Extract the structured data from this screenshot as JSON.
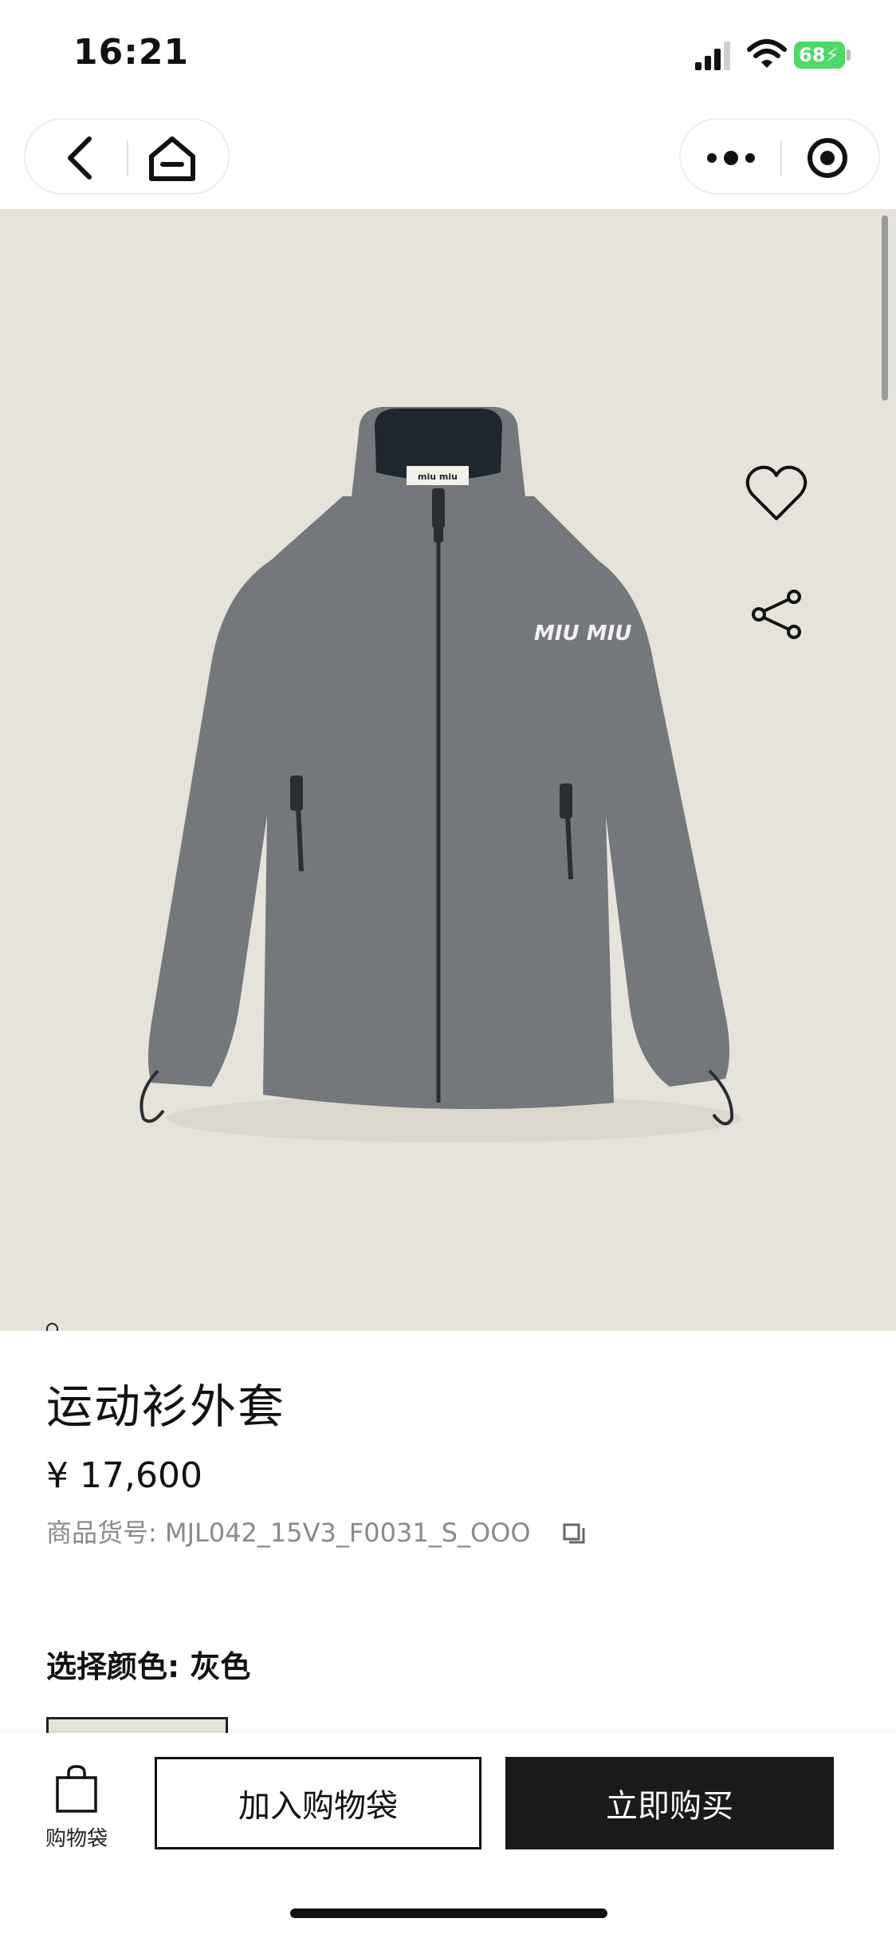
{
  "status_bar": {
    "time": "16:21",
    "battery_level": "68",
    "icons": [
      "signal-icon",
      "wifi-icon",
      "battery-charging-icon"
    ]
  },
  "nav": {
    "left_icons": [
      "back-icon",
      "home-icon"
    ],
    "right_icons": [
      "more-icon",
      "close-miniprogram-icon"
    ]
  },
  "gallery": {
    "background_color": "#e6e3da",
    "image_count": 6,
    "active_index": 1,
    "brand_text": "MIU MIU",
    "actions": [
      "heart-icon",
      "share-icon",
      "chat-icon"
    ]
  },
  "product": {
    "title": "运动衫外套",
    "price": "¥ 17,600",
    "sku": "商品货号: MJL042_15V3_F0031_S_OOO",
    "color_label": "选择颜色: 灰色"
  },
  "bottom_bar": {
    "bag_label": "购物袋",
    "add_to_cart_label": "加入购物袋",
    "buy_now_label": "立即购买"
  },
  "colors": {
    "accent_dark": "#1a1a1a",
    "battery_green": "#4cd964",
    "chat_dots_green": "#3aa655"
  }
}
